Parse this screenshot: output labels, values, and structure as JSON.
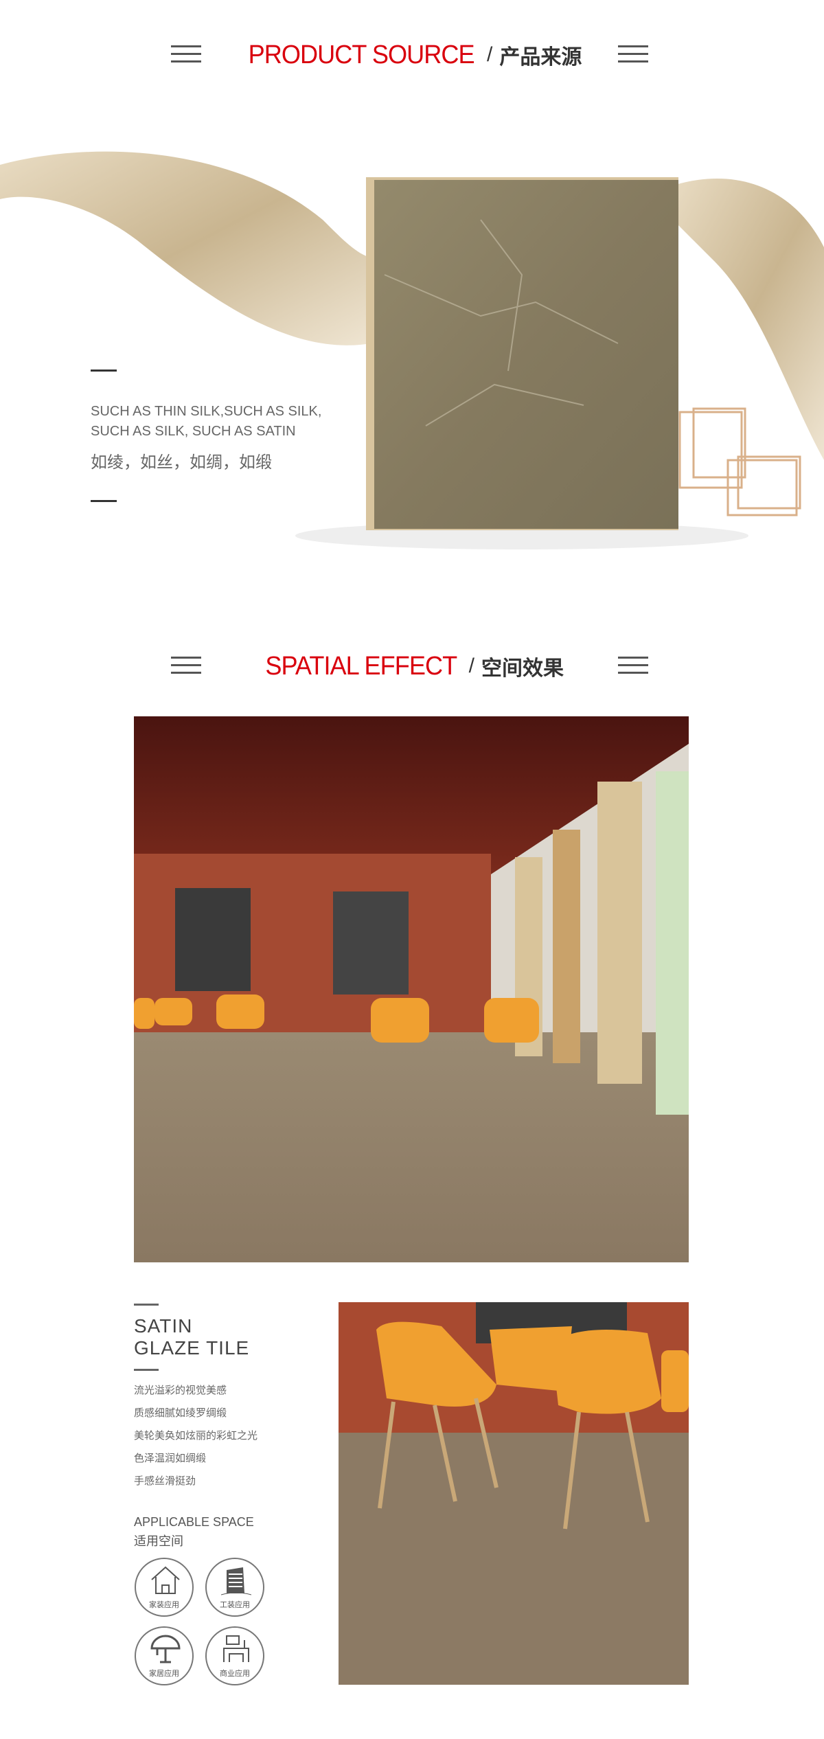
{
  "section1": {
    "title_en": "PRODUCT SOURCE",
    "separator": "/",
    "title_zh": "产品来源",
    "text_en_1": "SUCH AS THIN SILK,SUCH AS SILK,",
    "text_en_2": "SUCH AS SILK, SUCH AS SATIN",
    "text_zh": "如绫，如丝，如绸，如缎"
  },
  "section2": {
    "title_en": "SPATIAL EFFECT",
    "separator": "/",
    "title_zh": "空间效果"
  },
  "product": {
    "name_1": "SATIN",
    "name_2": "GLAZE TILE",
    "features": [
      "流光溢彩的视觉美感",
      "质感细腻如绫罗绸缎",
      "美轮美奂如炫丽的彩虹之光",
      "色泽温润如绸缎",
      "手感丝滑挺劲"
    ],
    "applicable_en": "APPLICABLE SPACE",
    "applicable_zh": "适用空间",
    "spaces": [
      {
        "label": "家装应用",
        "icon": "house-icon"
      },
      {
        "label": "工装应用",
        "icon": "building-icon"
      },
      {
        "label": "家居应用",
        "icon": "lamp-icon"
      },
      {
        "label": "商业应用",
        "icon": "office-desk-icon"
      }
    ]
  },
  "colors": {
    "accent": "#d9000d",
    "text": "#333333"
  }
}
